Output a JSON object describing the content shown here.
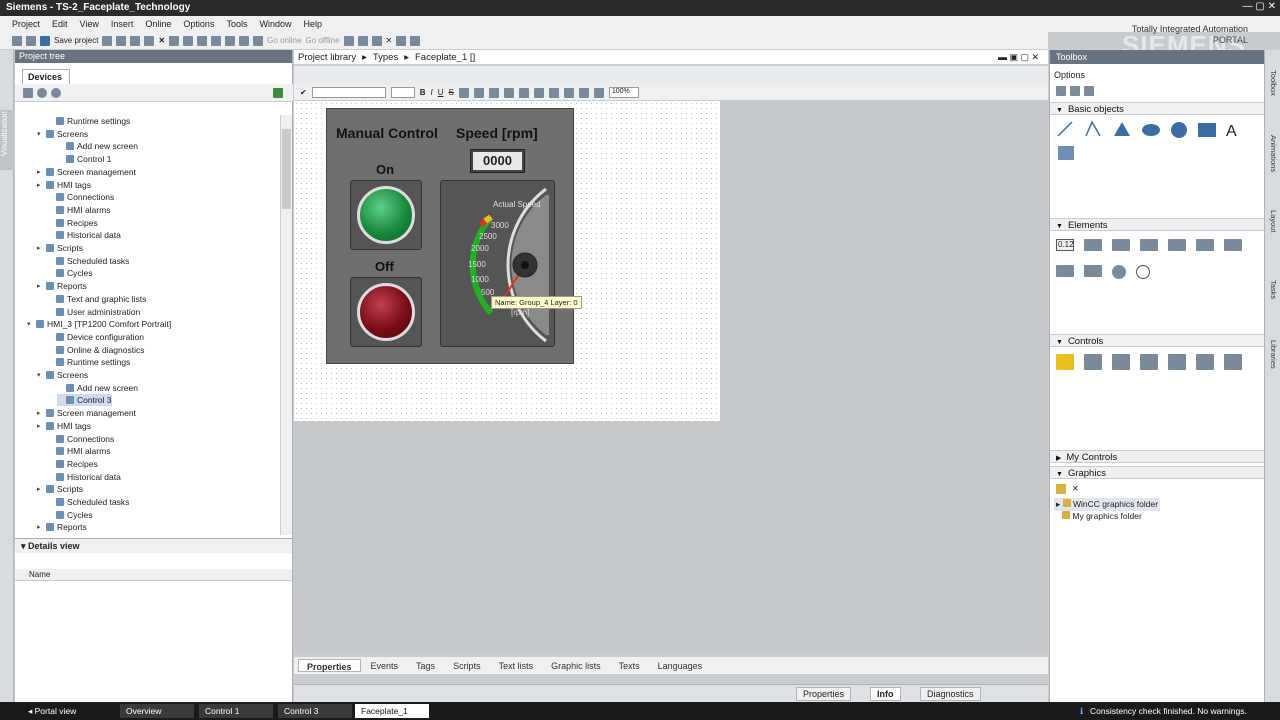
{
  "window": {
    "title": "Siemens - TS-2_Faceplate_Technology"
  },
  "menu": [
    "Project",
    "Edit",
    "View",
    "Insert",
    "Online",
    "Options",
    "Tools",
    "Window",
    "Help"
  ],
  "toolbar": {
    "save": "Save project",
    "go_online": "Go online",
    "go_offline": "Go offline"
  },
  "brand": {
    "tia": "Totally Integrated Automation",
    "portal": "PORTAL",
    "logo": "SIEMENS"
  },
  "left_strip": {
    "visualization": "Visualization"
  },
  "project_tree": {
    "title": "Project tree",
    "tab": "Devices",
    "items": [
      {
        "label": "Runtime settings",
        "indent": 3
      },
      {
        "label": "Screens",
        "indent": 2,
        "arrow": "▾"
      },
      {
        "label": "Add new screen",
        "indent": 4
      },
      {
        "label": "Control 1",
        "indent": 4
      },
      {
        "label": "Screen management",
        "indent": 2,
        "arrow": "▸"
      },
      {
        "label": "HMI tags",
        "indent": 2,
        "arrow": "▸"
      },
      {
        "label": "Connections",
        "indent": 3
      },
      {
        "label": "HMI alarms",
        "indent": 3
      },
      {
        "label": "Recipes",
        "indent": 3
      },
      {
        "label": "Historical data",
        "indent": 3
      },
      {
        "label": "Scripts",
        "indent": 2,
        "arrow": "▸"
      },
      {
        "label": "Scheduled tasks",
        "indent": 3
      },
      {
        "label": "Cycles",
        "indent": 3
      },
      {
        "label": "Reports",
        "indent": 2,
        "arrow": "▸"
      },
      {
        "label": "Text and graphic lists",
        "indent": 3
      },
      {
        "label": "User administration",
        "indent": 3
      },
      {
        "label": "HMI_3 [TP1200 Comfort Portrait]",
        "indent": 1,
        "arrow": "▾"
      },
      {
        "label": "Device configuration",
        "indent": 3
      },
      {
        "label": "Online & diagnostics",
        "indent": 3
      },
      {
        "label": "Runtime settings",
        "indent": 3
      },
      {
        "label": "Screens",
        "indent": 2,
        "arrow": "▾"
      },
      {
        "label": "Add new screen",
        "indent": 4
      },
      {
        "label": "Control 3",
        "indent": 4,
        "selected": true
      },
      {
        "label": "Screen management",
        "indent": 2,
        "arrow": "▸"
      },
      {
        "label": "HMI tags",
        "indent": 2,
        "arrow": "▸"
      },
      {
        "label": "Connections",
        "indent": 3
      },
      {
        "label": "HMI alarms",
        "indent": 3
      },
      {
        "label": "Recipes",
        "indent": 3
      },
      {
        "label": "Historical data",
        "indent": 3
      },
      {
        "label": "Scripts",
        "indent": 2,
        "arrow": "▸"
      },
      {
        "label": "Scheduled tasks",
        "indent": 3
      },
      {
        "label": "Cycles",
        "indent": 3
      },
      {
        "label": "Reports",
        "indent": 2,
        "arrow": "▸"
      }
    ]
  },
  "details_view": {
    "title": "Details view",
    "col_name": "Name"
  },
  "editor": {
    "breadcrumb": [
      "Project library",
      "Types",
      "Faceplate_1 []"
    ],
    "zoom": "100%"
  },
  "faceplate": {
    "title": "Manual Control",
    "speed_label": "Speed [rpm]",
    "value": "0000",
    "on_label": "On",
    "off_label": "Off",
    "gauge_title": "Actual Speed",
    "gauge_unit": "[rpm]",
    "gauge_ticks": [
      "3000",
      "2500",
      "2000",
      "1500",
      "1000",
      "500"
    ],
    "tooltip": "Name: Group_4   Layer: 0",
    "colors": {
      "on": "#1a8a3e",
      "off": "#7a0d16",
      "panel": "#6f6f6f"
    }
  },
  "bottom_tabs": [
    "Properties",
    "Events",
    "Tags",
    "Scripts",
    "Text lists",
    "Graphic lists",
    "Texts",
    "Languages"
  ],
  "inspector_tabs": {
    "properties": "Properties",
    "info": "Info",
    "diagnostics": "Diagnostics"
  },
  "toolbox": {
    "title": "Toolbox",
    "options": "Options",
    "sections": {
      "basic": "Basic objects",
      "elements": "Elements",
      "controls": "Controls",
      "my_controls": "My Controls",
      "graphics": "Graphics"
    },
    "graphics_items": [
      "WinCC graphics folder",
      "My graphics folder"
    ],
    "text_tool": "A",
    "num_field": "0.12"
  },
  "right_strip": [
    "Toolbox",
    "Animations",
    "Layout",
    "Tasks",
    "Libraries"
  ],
  "taskbar": {
    "portal_view": "Portal view",
    "tasks": [
      "Overview",
      "Control 1",
      "Control 3",
      "Faceplate_1"
    ],
    "status": "Consistency check finished. No warnings."
  }
}
